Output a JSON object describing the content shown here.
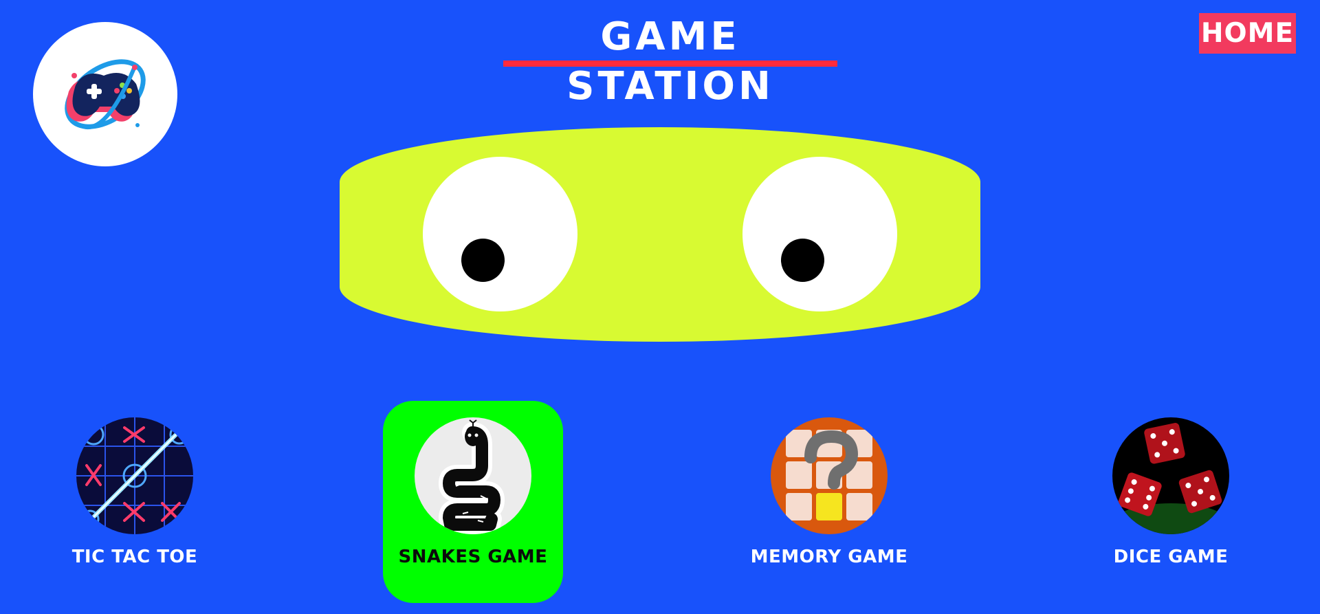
{
  "header": {
    "title": "GAME STATION",
    "home_label": "HOME",
    "logo_icon": "gamepad-icon"
  },
  "mascot": {
    "description_icon": "eyes-face"
  },
  "games": [
    {
      "label": "TIC TAC TOE",
      "icon": "tic-tac-toe-icon",
      "selected": false
    },
    {
      "label": "SNAKES GAME",
      "icon": "snake-icon",
      "selected": true
    },
    {
      "label": "MEMORY GAME",
      "icon": "memory-grid-icon",
      "selected": false
    },
    {
      "label": "DICE GAME",
      "icon": "dice-icon",
      "selected": false
    }
  ],
  "colors": {
    "background": "#1852fb",
    "title_underline": "#ff2b3c",
    "home_button": "#f23a5e",
    "face": "#d8fa32",
    "selected_tile": "#00ff00"
  }
}
